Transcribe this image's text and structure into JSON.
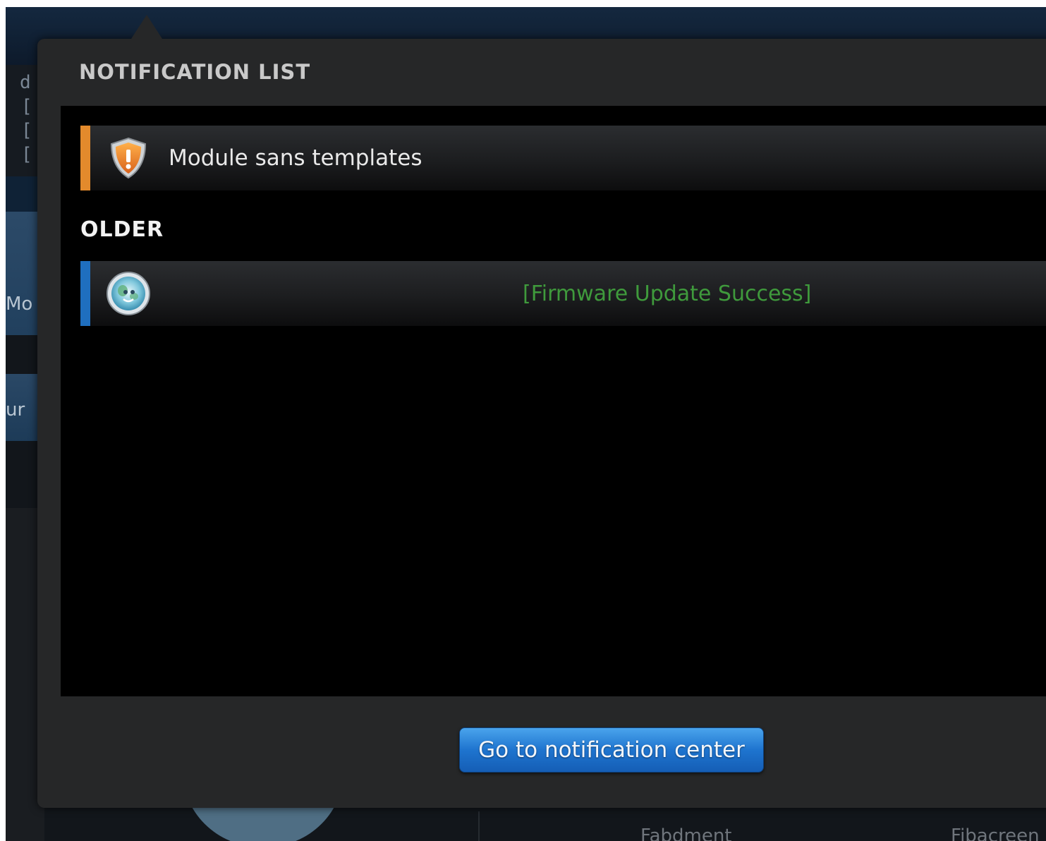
{
  "background": {
    "fragments": {
      "top_line": "d",
      "bracket_lines": [
        "[",
        "[",
        "["
      ],
      "tile_label": "Mo",
      "tile2_label": "ur",
      "bottom_left": "Fabdment",
      "bottom_right": "Fibacreen"
    }
  },
  "popup": {
    "title": "NOTIFICATION LIST",
    "notifications": [
      {
        "text": "Module sans templates",
        "icon": "warning-shield-icon",
        "accent_color": "#e38a2c"
      }
    ],
    "older_label": "OLDER",
    "older_notifications": [
      {
        "text": "[Firmware Update Success]",
        "icon": "firmware-globe-icon",
        "accent_color": "#1f6fbf",
        "text_color": "#3f9a3c"
      }
    ],
    "goto_button_label": "Go to notification center"
  }
}
